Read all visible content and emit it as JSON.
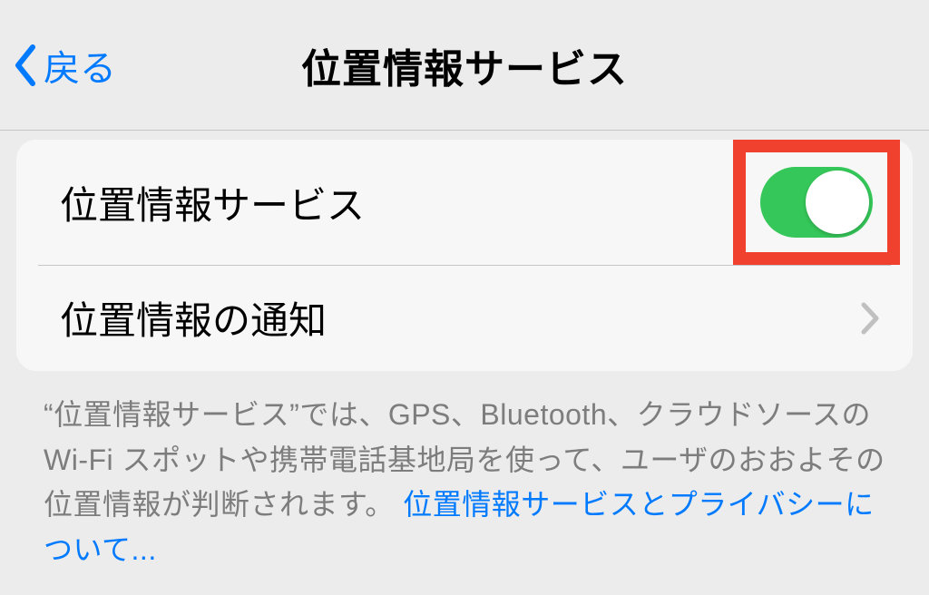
{
  "header": {
    "back_label": "戻る",
    "title": "位置情報サービス"
  },
  "rows": {
    "location_services": {
      "label": "位置情報サービス",
      "enabled": true
    },
    "location_alerts": {
      "label": "位置情報の通知"
    }
  },
  "footer": {
    "description": "“位置情報サービス”では、GPS、Bluetooth、クラウドソースの Wi-Fi スポットや携帯電話基地局を使って、ユーザのおおよその位置情報が判断されます。 ",
    "link_text": "位置情報サービスとプライバシーについて..."
  },
  "colors": {
    "accent": "#007aff",
    "toggle_on": "#35c759",
    "highlight_box": "#ef412e"
  }
}
